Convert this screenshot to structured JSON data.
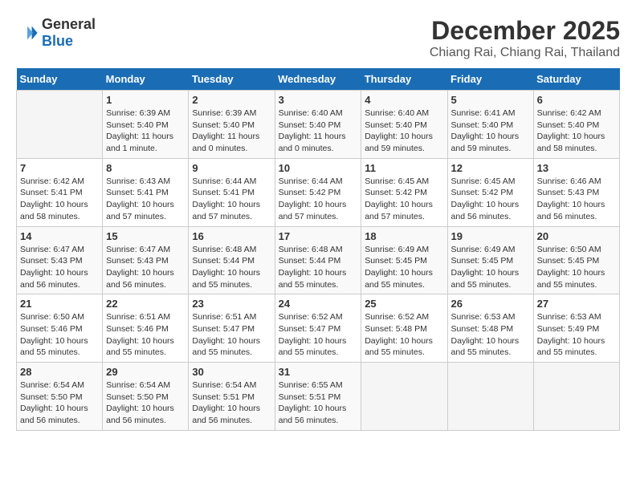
{
  "header": {
    "logo_general": "General",
    "logo_blue": "Blue",
    "title": "December 2025",
    "subtitle": "Chiang Rai, Chiang Rai, Thailand"
  },
  "calendar": {
    "days_of_week": [
      "Sunday",
      "Monday",
      "Tuesday",
      "Wednesday",
      "Thursday",
      "Friday",
      "Saturday"
    ],
    "weeks": [
      [
        {
          "day": "",
          "sunrise": "",
          "sunset": "",
          "daylight": ""
        },
        {
          "day": "1",
          "sunrise": "Sunrise: 6:39 AM",
          "sunset": "Sunset: 5:40 PM",
          "daylight": "Daylight: 11 hours and 1 minute."
        },
        {
          "day": "2",
          "sunrise": "Sunrise: 6:39 AM",
          "sunset": "Sunset: 5:40 PM",
          "daylight": "Daylight: 11 hours and 0 minutes."
        },
        {
          "day": "3",
          "sunrise": "Sunrise: 6:40 AM",
          "sunset": "Sunset: 5:40 PM",
          "daylight": "Daylight: 11 hours and 0 minutes."
        },
        {
          "day": "4",
          "sunrise": "Sunrise: 6:40 AM",
          "sunset": "Sunset: 5:40 PM",
          "daylight": "Daylight: 10 hours and 59 minutes."
        },
        {
          "day": "5",
          "sunrise": "Sunrise: 6:41 AM",
          "sunset": "Sunset: 5:40 PM",
          "daylight": "Daylight: 10 hours and 59 minutes."
        },
        {
          "day": "6",
          "sunrise": "Sunrise: 6:42 AM",
          "sunset": "Sunset: 5:40 PM",
          "daylight": "Daylight: 10 hours and 58 minutes."
        }
      ],
      [
        {
          "day": "7",
          "sunrise": "Sunrise: 6:42 AM",
          "sunset": "Sunset: 5:41 PM",
          "daylight": "Daylight: 10 hours and 58 minutes."
        },
        {
          "day": "8",
          "sunrise": "Sunrise: 6:43 AM",
          "sunset": "Sunset: 5:41 PM",
          "daylight": "Daylight: 10 hours and 57 minutes."
        },
        {
          "day": "9",
          "sunrise": "Sunrise: 6:44 AM",
          "sunset": "Sunset: 5:41 PM",
          "daylight": "Daylight: 10 hours and 57 minutes."
        },
        {
          "day": "10",
          "sunrise": "Sunrise: 6:44 AM",
          "sunset": "Sunset: 5:42 PM",
          "daylight": "Daylight: 10 hours and 57 minutes."
        },
        {
          "day": "11",
          "sunrise": "Sunrise: 6:45 AM",
          "sunset": "Sunset: 5:42 PM",
          "daylight": "Daylight: 10 hours and 57 minutes."
        },
        {
          "day": "12",
          "sunrise": "Sunrise: 6:45 AM",
          "sunset": "Sunset: 5:42 PM",
          "daylight": "Daylight: 10 hours and 56 minutes."
        },
        {
          "day": "13",
          "sunrise": "Sunrise: 6:46 AM",
          "sunset": "Sunset: 5:43 PM",
          "daylight": "Daylight: 10 hours and 56 minutes."
        }
      ],
      [
        {
          "day": "14",
          "sunrise": "Sunrise: 6:47 AM",
          "sunset": "Sunset: 5:43 PM",
          "daylight": "Daylight: 10 hours and 56 minutes."
        },
        {
          "day": "15",
          "sunrise": "Sunrise: 6:47 AM",
          "sunset": "Sunset: 5:43 PM",
          "daylight": "Daylight: 10 hours and 56 minutes."
        },
        {
          "day": "16",
          "sunrise": "Sunrise: 6:48 AM",
          "sunset": "Sunset: 5:44 PM",
          "daylight": "Daylight: 10 hours and 55 minutes."
        },
        {
          "day": "17",
          "sunrise": "Sunrise: 6:48 AM",
          "sunset": "Sunset: 5:44 PM",
          "daylight": "Daylight: 10 hours and 55 minutes."
        },
        {
          "day": "18",
          "sunrise": "Sunrise: 6:49 AM",
          "sunset": "Sunset: 5:45 PM",
          "daylight": "Daylight: 10 hours and 55 minutes."
        },
        {
          "day": "19",
          "sunrise": "Sunrise: 6:49 AM",
          "sunset": "Sunset: 5:45 PM",
          "daylight": "Daylight: 10 hours and 55 minutes."
        },
        {
          "day": "20",
          "sunrise": "Sunrise: 6:50 AM",
          "sunset": "Sunset: 5:45 PM",
          "daylight": "Daylight: 10 hours and 55 minutes."
        }
      ],
      [
        {
          "day": "21",
          "sunrise": "Sunrise: 6:50 AM",
          "sunset": "Sunset: 5:46 PM",
          "daylight": "Daylight: 10 hours and 55 minutes."
        },
        {
          "day": "22",
          "sunrise": "Sunrise: 6:51 AM",
          "sunset": "Sunset: 5:46 PM",
          "daylight": "Daylight: 10 hours and 55 minutes."
        },
        {
          "day": "23",
          "sunrise": "Sunrise: 6:51 AM",
          "sunset": "Sunset: 5:47 PM",
          "daylight": "Daylight: 10 hours and 55 minutes."
        },
        {
          "day": "24",
          "sunrise": "Sunrise: 6:52 AM",
          "sunset": "Sunset: 5:47 PM",
          "daylight": "Daylight: 10 hours and 55 minutes."
        },
        {
          "day": "25",
          "sunrise": "Sunrise: 6:52 AM",
          "sunset": "Sunset: 5:48 PM",
          "daylight": "Daylight: 10 hours and 55 minutes."
        },
        {
          "day": "26",
          "sunrise": "Sunrise: 6:53 AM",
          "sunset": "Sunset: 5:48 PM",
          "daylight": "Daylight: 10 hours and 55 minutes."
        },
        {
          "day": "27",
          "sunrise": "Sunrise: 6:53 AM",
          "sunset": "Sunset: 5:49 PM",
          "daylight": "Daylight: 10 hours and 55 minutes."
        }
      ],
      [
        {
          "day": "28",
          "sunrise": "Sunrise: 6:54 AM",
          "sunset": "Sunset: 5:50 PM",
          "daylight": "Daylight: 10 hours and 56 minutes."
        },
        {
          "day": "29",
          "sunrise": "Sunrise: 6:54 AM",
          "sunset": "Sunset: 5:50 PM",
          "daylight": "Daylight: 10 hours and 56 minutes."
        },
        {
          "day": "30",
          "sunrise": "Sunrise: 6:54 AM",
          "sunset": "Sunset: 5:51 PM",
          "daylight": "Daylight: 10 hours and 56 minutes."
        },
        {
          "day": "31",
          "sunrise": "Sunrise: 6:55 AM",
          "sunset": "Sunset: 5:51 PM",
          "daylight": "Daylight: 10 hours and 56 minutes."
        },
        {
          "day": "",
          "sunrise": "",
          "sunset": "",
          "daylight": ""
        },
        {
          "day": "",
          "sunrise": "",
          "sunset": "",
          "daylight": ""
        },
        {
          "day": "",
          "sunrise": "",
          "sunset": "",
          "daylight": ""
        }
      ]
    ]
  }
}
